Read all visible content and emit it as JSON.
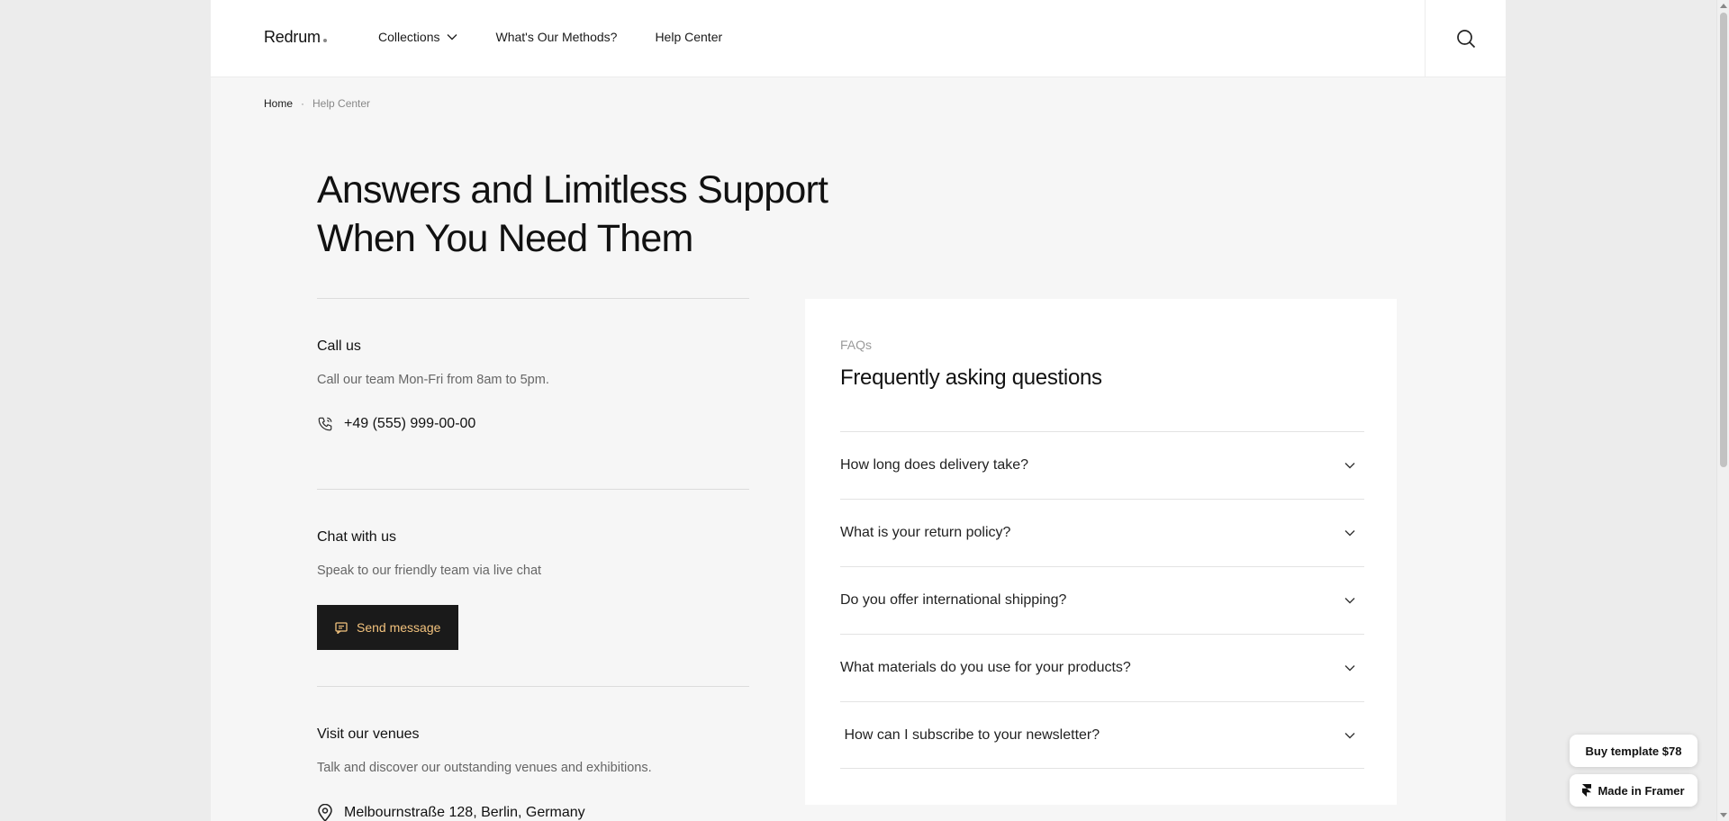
{
  "header": {
    "logo": "Redrum",
    "nav": [
      {
        "label": "Collections",
        "has_dropdown": true
      },
      {
        "label": "What's Our Methods?"
      },
      {
        "label": "Help Center"
      }
    ],
    "search_icon": "search-icon"
  },
  "breadcrumb": {
    "home": "Home",
    "separator": "·",
    "current": "Help Center"
  },
  "hero": {
    "title_line1": "Answers and Limitless Support",
    "title_line2": "When You Need Them"
  },
  "contact": {
    "call": {
      "heading": "Call us",
      "description": "Call our team Mon-Fri from 8am to 5pm.",
      "phone": "+49 (555) 999-00-00",
      "icon": "phone-icon"
    },
    "chat": {
      "heading": "Chat with us",
      "description": "Speak to our friendly team via live chat",
      "button_label": "Send message",
      "icon": "message-icon"
    },
    "visit": {
      "heading": "Visit our venues",
      "description": "Talk and discover our outstanding venues and exhibitions.",
      "address": "Melbournstraße 128, Berlin, Germany",
      "icon": "location-pin-icon"
    }
  },
  "faq": {
    "eyebrow": "FAQs",
    "title": "Frequently asking questions",
    "items": [
      {
        "question": "How long does delivery take?"
      },
      {
        "question": "What is your return policy?"
      },
      {
        "question": "Do you offer international shipping?"
      },
      {
        "question": "What materials do you use for your products?"
      },
      {
        "question": " How can I subscribe to your newsletter?"
      }
    ]
  },
  "floating": {
    "buy_label": "Buy template $78",
    "framer_label": "Made in Framer"
  },
  "colors": {
    "accent_button_bg": "#1a1a1a",
    "accent_button_text": "#f2c27d",
    "page_bg": "#f6f6f6"
  }
}
